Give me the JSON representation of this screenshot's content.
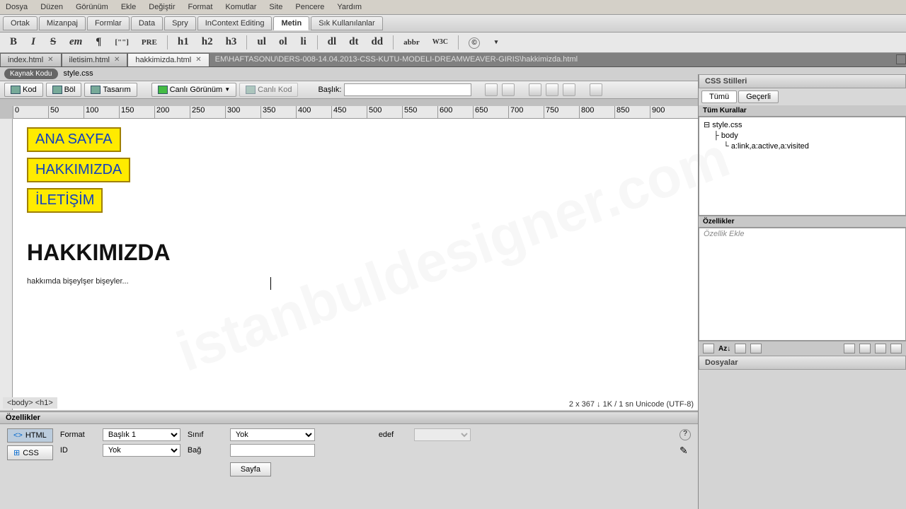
{
  "menubar": [
    "Dosya",
    "Düzen",
    "Görünüm",
    "Ekle",
    "Değiştir",
    "Format",
    "Komutlar",
    "Site",
    "Pencere",
    "Yardım"
  ],
  "insert_tabs": [
    "Ortak",
    "Mizanpaj",
    "Formlar",
    "Data",
    "Spry",
    "InContext Editing",
    "Metin",
    "Sık Kullanılanlar"
  ],
  "insert_active": 6,
  "format_buttons": [
    "B",
    "I",
    "S",
    "em",
    "¶",
    "[\"\"]",
    "PRE",
    "h1",
    "h2",
    "h3",
    "ul",
    "ol",
    "li",
    "dl",
    "dt",
    "dd",
    "abbr",
    "W3C",
    "©",
    "▾"
  ],
  "doc_tabs": [
    {
      "name": "index.html",
      "active": false
    },
    {
      "name": "iletisim.html",
      "active": false
    },
    {
      "name": "hakkimizda.html",
      "active": true
    }
  ],
  "doc_path": "EM\\HAFTASONU\\DERS-008-14.04.2013-CSS-KUTU-MODELI-DREAMWEAVER-GIRIS\\hakkimizda.html",
  "source_btn": "Kaynak Kodu",
  "style_file": "style.css",
  "view_buttons": {
    "kod": "Kod",
    "bol": "Böl",
    "tasarim": "Tasarım",
    "canli": "Canlı Görünüm",
    "canlikod": "Canlı Kod"
  },
  "title_label": "Başlık:",
  "ruler_marks": [
    "0",
    "50",
    "100",
    "150",
    "200",
    "250",
    "300",
    "350",
    "400",
    "450",
    "500",
    "550",
    "600",
    "650",
    "700",
    "750",
    "800",
    "850",
    "900"
  ],
  "nav_links": [
    "ANA SAYFA",
    "HAKKIMIZDA",
    "İLETİŞİM"
  ],
  "page": {
    "heading": "HAKKIMIZDA",
    "para": "hakkımda bişeylşer bişeyler..."
  },
  "tag_selector": "<body> <h1>",
  "status": "2 x 367 ↓   1K / 1 sn   Unicode (UTF-8)",
  "css_panel": {
    "title": "CSS Stilleri",
    "tabs": [
      "Tümü",
      "Geçerli"
    ],
    "rules_hdr": "Tüm Kurallar",
    "tree": [
      "style.css",
      "body",
      "a:link,a:active,a:visited"
    ],
    "props_hdr": "Özellikler",
    "props_add": "Özellik Ekle"
  },
  "prop_inspector": {
    "title": "Özellikler",
    "html_btn": "HTML",
    "css_btn": "CSS",
    "format_lbl": "Format",
    "format_val": "Başlık 1",
    "id_lbl": "ID",
    "id_val": "Yok",
    "sinif_lbl": "Sınıf",
    "sinif_val": "Yok",
    "bag_lbl": "Bağ",
    "bag_val": "",
    "hedef_lbl": "edef",
    "page_btn": "Sayfa"
  },
  "files_panel": "Dosyalar"
}
